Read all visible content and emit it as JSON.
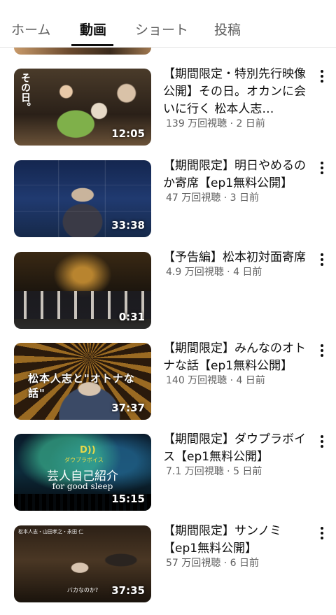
{
  "tabs": [
    {
      "label": "ホーム",
      "active": false
    },
    {
      "label": "動画",
      "active": true
    },
    {
      "label": "ショート",
      "active": false
    },
    {
      "label": "投稿",
      "active": false
    }
  ],
  "videos": [
    {
      "title": "【期間限定・特別先行映像公開】その日。オカンに会いに行く 松本人志…",
      "duration": "12:05",
      "views": "139 万回視聴",
      "age": "2 日前",
      "thumb_text": "その日。"
    },
    {
      "title": "【期間限定】明日やめるのか寄席【ep1無料公開】",
      "duration": "33:38",
      "views": "47 万回視聴",
      "age": "3 日前"
    },
    {
      "title": "【予告編】松本初対面寄席",
      "duration": "0:31",
      "views": "4.9 万回視聴",
      "age": "4 日前"
    },
    {
      "title": "【期間限定】みんなのオトナな話【ep1無料公開】",
      "duration": "37:37",
      "views": "140 万回視聴",
      "age": "4 日前",
      "thumb_text": "松本人志と\"オトナな話\""
    },
    {
      "title": "【期間限定】ダウプラボイス【ep1無料公開】",
      "duration": "15:15",
      "views": "7.1 万回視聴",
      "age": "5 日前",
      "thumb_logo": "D))",
      "thumb_brand": "ダウプラボイス",
      "thumb_text": "芸人自己紹介",
      "thumb_sub": "for good sleep"
    },
    {
      "title": "【期間限定】サンノミ【ep1無料公開】",
      "duration": "37:35",
      "views": "57 万回視聴",
      "age": "6 日前",
      "thumb_top": "松本人志・山田孝之・永田 仁",
      "thumb_text": "バカなのか?"
    }
  ],
  "separator": " · "
}
